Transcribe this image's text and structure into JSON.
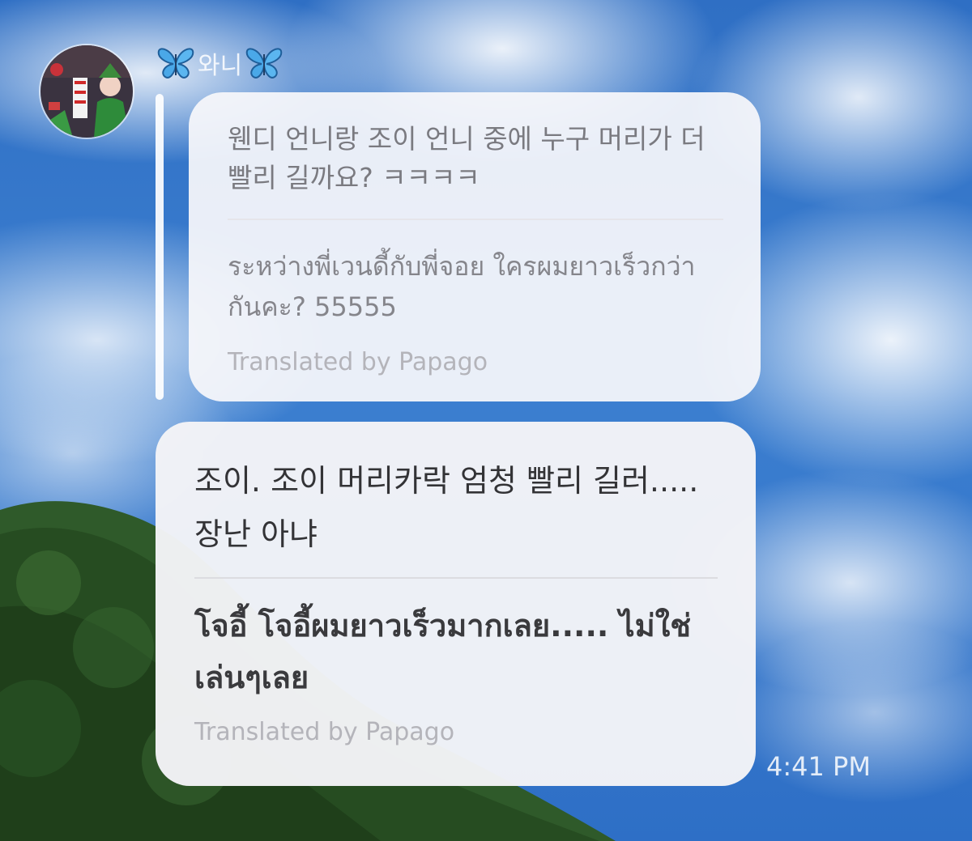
{
  "sender": {
    "name": "와니",
    "left_icon": "butterfly-icon",
    "right_icon": "butterfly-icon"
  },
  "quoted_message": {
    "original": "웬디 언니랑 조이 언니 중에 누구 머리가 더 빨리 길까요? ㅋㅋㅋㅋ",
    "translation": "ระหว่างพี่เวนดี้กับพี่จอย ใครผมยาวเร็วกว่ากันคะ? 55555",
    "credit": "Translated by Papago"
  },
  "reply_message": {
    "original": "조이. 조이 머리카락 엄청 빨리 길러..... 장난 아냐",
    "translation": "โจอี้ โจอี้ผมยาวเร็วมากเลย..... ไม่ใช่เล่นๆเลย",
    "credit": "Translated by Papago",
    "time": "4:41 PM"
  },
  "colors": {
    "sky": "#3c7fd0",
    "bubble": "#f4f4f7",
    "butterfly": "#4aa8e8",
    "foliage": "#2f5a2a"
  }
}
